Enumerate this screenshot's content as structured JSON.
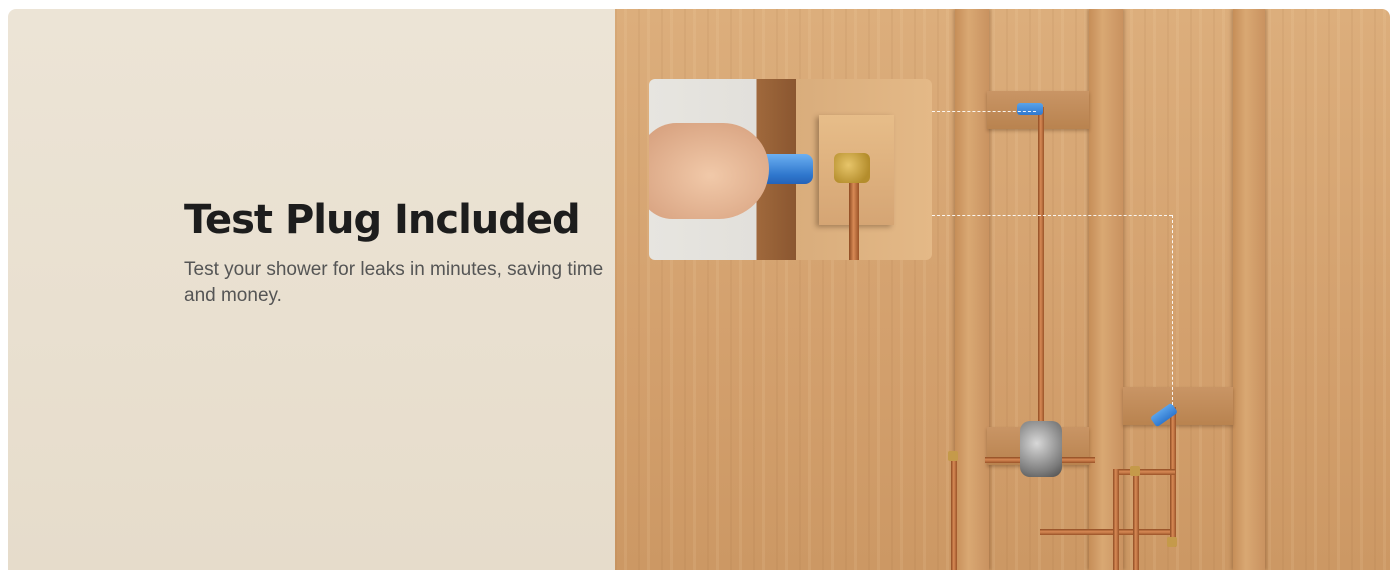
{
  "hero": {
    "title": "Test Plug Included",
    "description": "Test your shower for leaks in minutes, saving time and money."
  },
  "colors": {
    "text_panel_bg": "#ebe3d4",
    "title_color": "#1d1d1d",
    "body_color": "#555555",
    "plug_blue": "#2f78cf",
    "copper": "#c7753f"
  },
  "images": {
    "main_scene": "shower-valve-installed-in-wood-frame",
    "inset_detail": "hand-inserting-blue-test-plug"
  }
}
